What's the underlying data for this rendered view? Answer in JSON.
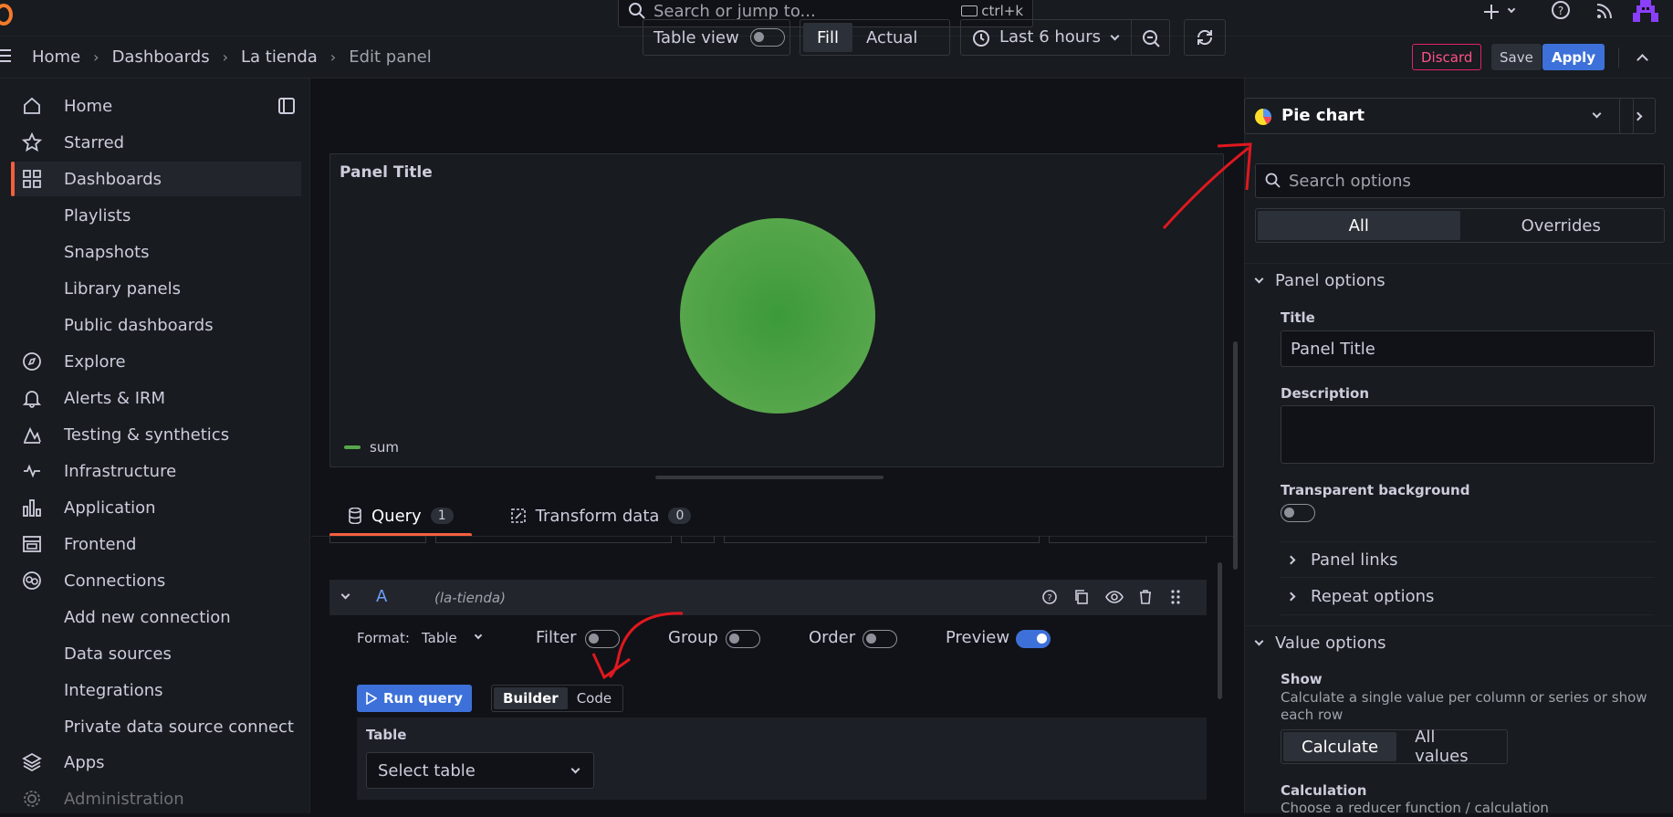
{
  "topbar": {
    "search_placeholder": "Search or jump to...",
    "search_shortcut": "ctrl+k"
  },
  "breadcrumb": [
    "Home",
    "Dashboards",
    "La tienda",
    "Edit panel"
  ],
  "actions": {
    "discard": "Discard",
    "save": "Save",
    "apply": "Apply"
  },
  "sidebar": {
    "items": [
      {
        "label": "Home",
        "icon": "home-icon"
      },
      {
        "label": "Starred",
        "icon": "star-icon"
      },
      {
        "label": "Dashboards",
        "icon": "apps-icon",
        "active": true
      },
      {
        "label": "Playlists"
      },
      {
        "label": "Snapshots"
      },
      {
        "label": "Library panels"
      },
      {
        "label": "Public dashboards"
      },
      {
        "label": "Explore",
        "icon": "compass-icon"
      },
      {
        "label": "Alerts & IRM",
        "icon": "bell-icon"
      },
      {
        "label": "Testing & synthetics",
        "icon": "testing-icon"
      },
      {
        "label": "Infrastructure",
        "icon": "heartbeat-icon"
      },
      {
        "label": "Application",
        "icon": "bar-chart-icon"
      },
      {
        "label": "Frontend",
        "icon": "frontend-icon"
      },
      {
        "label": "Connections",
        "icon": "connections-icon"
      },
      {
        "label": "Add new connection"
      },
      {
        "label": "Data sources"
      },
      {
        "label": "Integrations"
      },
      {
        "label": "Private data source connect"
      },
      {
        "label": "Apps",
        "icon": "layers-icon"
      },
      {
        "label": "Administration",
        "icon": "cog-icon"
      }
    ]
  },
  "toolbar": {
    "table_view": "Table view",
    "fill": "Fill",
    "actual": "Actual",
    "time_range": "Last 6 hours"
  },
  "panel": {
    "title": "Panel Title",
    "legend": "sum"
  },
  "tabs": [
    {
      "label": "Query",
      "count": "1"
    },
    {
      "label": "Transform data",
      "count": "0"
    }
  ],
  "query": {
    "ref": "A",
    "datasource": "(la-tienda)",
    "format_label": "Format:",
    "format_value": "Table",
    "filter": "Filter",
    "group": "Group",
    "order": "Order",
    "preview": "Preview",
    "run_query": "Run query",
    "builder": "Builder",
    "code": "Code",
    "table_label": "Table",
    "select_table": "Select table"
  },
  "options": {
    "visualization": "Pie chart",
    "search_placeholder": "Search options",
    "all": "All",
    "overrides": "Overrides",
    "panel_options": "Panel options",
    "title_label": "Title",
    "title_value": "Panel Title",
    "description_label": "Description",
    "transparent_label": "Transparent background",
    "panel_links": "Panel links",
    "repeat_options": "Repeat options",
    "value_options": "Value options",
    "show_label": "Show",
    "show_desc": "Calculate a single value per column or series or show each row",
    "calculate": "Calculate",
    "all_values": "All values",
    "calculation_label": "Calculation",
    "calculation_desc": "Choose a reducer function / calculation"
  },
  "colors": {
    "accent": "#3d71d9",
    "active_nav": "#f55f3e",
    "pie": "#56a64b",
    "discard": "#ff5286",
    "annotation": "#e0181f"
  }
}
